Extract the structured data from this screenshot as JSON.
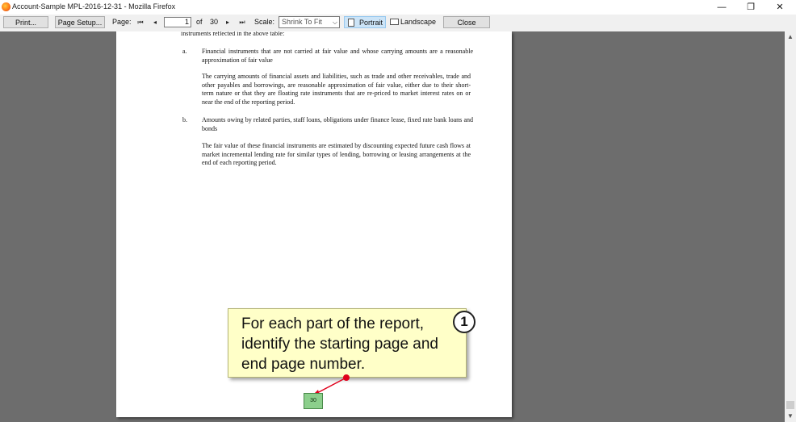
{
  "window": {
    "title": "Account-Sample MPL-2016-12-31 - Mozilla Firefox",
    "minimize_glyph": "—",
    "restore_glyph": "❐",
    "close_glyph": "✕"
  },
  "toolbar": {
    "print_label": "Print...",
    "page_setup_label": "Page Setup...",
    "page_label": "Page:",
    "first_glyph": "⏮",
    "prev_glyph": "◂",
    "current_page": "1",
    "of_label": "of",
    "total_pages": "30",
    "next_glyph": "▸",
    "last_glyph": "⏭",
    "scale_label": "Scale:",
    "scale_value": "Shrink To Fit",
    "scale_arrow": "⌵",
    "portrait_label": "Portrait",
    "landscape_label": "Landscape",
    "close_label": "Close"
  },
  "document": {
    "top_line": "instruments reflected in the above table:",
    "item_a_marker": "a.",
    "item_a_heading": "Financial instruments that are not carried at fair value and whose carrying amounts are a reasonable approximation of fair value",
    "item_a_body": "The carrying amounts of financial assets and liabilities, such as trade and other receivables, trade and other payables and borrowings, are reasonable approximation of fair value, either due to their short-term nature or that they are floating rate instruments that are re-priced to market interest rates on or near the end of the reporting period.",
    "item_b_marker": "b.",
    "item_b_heading": "Amounts owing by related parties, staff loans, obligations under finance lease, fixed rate bank loans and bonds",
    "item_b_body": "The fair value of these financial instruments are estimated by discounting expected future cash flows at market incremental lending rate for similar types of lending, borrowing or leasing arrangements at the end of each reporting period.",
    "page_number": "30"
  },
  "callout": {
    "text": "For each part of the report, identify the starting page and end page number.",
    "step": "1"
  },
  "scrollbar": {
    "up_glyph": "▲",
    "down_glyph": "▼"
  },
  "colors": {
    "callout_bg": "#ffffc8",
    "arrow": "#e0001b",
    "page_number_bg": "#8ccf8c",
    "viewer_bg": "#6d6d6d"
  }
}
